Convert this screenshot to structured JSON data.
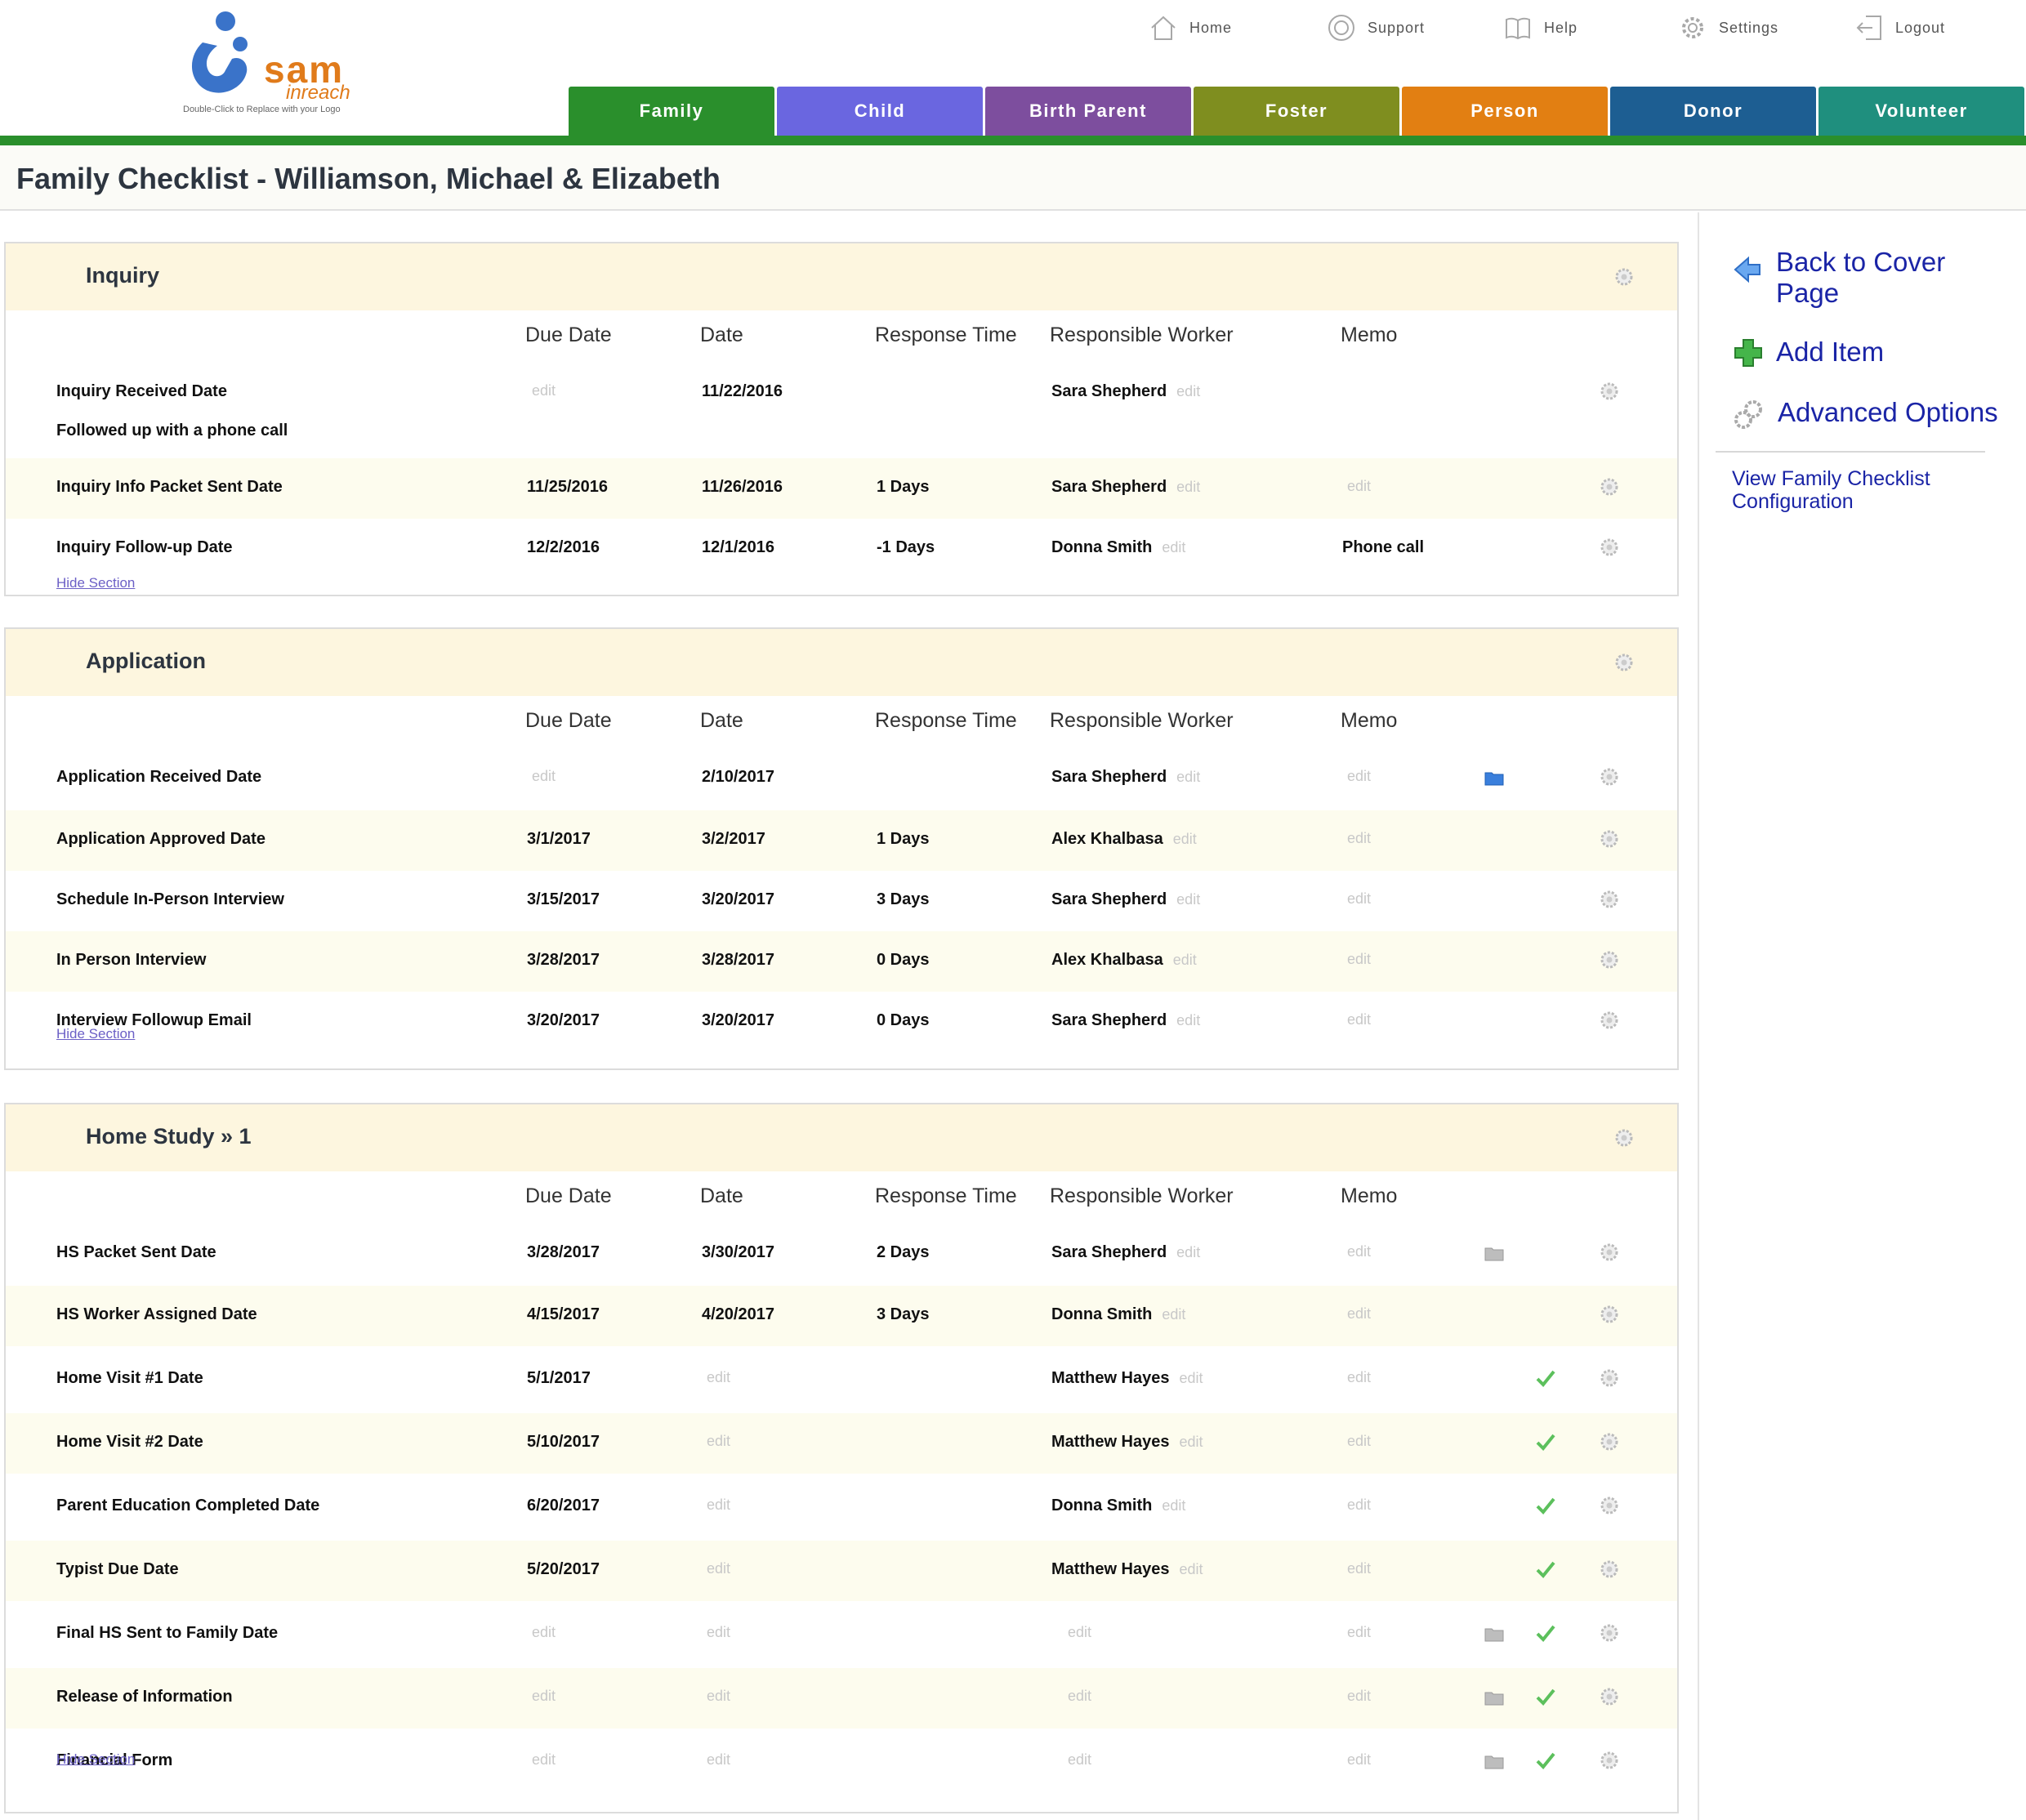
{
  "logo": {
    "brand": "sam",
    "sub": "inreach",
    "caption": "Double-Click to Replace with your Logo"
  },
  "topnav": [
    {
      "label": "Home",
      "icon": "home-icon"
    },
    {
      "label": "Support",
      "icon": "lifebuoy-icon"
    },
    {
      "label": "Help",
      "icon": "book-icon"
    },
    {
      "label": "Settings",
      "icon": "gear-icon"
    },
    {
      "label": "Logout",
      "icon": "logout-icon"
    }
  ],
  "tabs": [
    {
      "label": "Family",
      "color": "#2a8f2c"
    },
    {
      "label": "Child",
      "color": "#6a66e0"
    },
    {
      "label": "Birth Parent",
      "color": "#7d4e9e"
    },
    {
      "label": "Foster",
      "color": "#7f8e1f"
    },
    {
      "label": "Person",
      "color": "#e27f12"
    },
    {
      "label": "Donor",
      "color": "#1d5e92"
    },
    {
      "label": "Volunteer",
      "color": "#1f8f7e"
    }
  ],
  "page_title": "Family Checklist - Williamson, Michael & Elizabeth",
  "columns": {
    "due_date": "Due Date",
    "date": "Date",
    "response_time": "Response Time",
    "worker": "Responsible Worker",
    "memo": "Memo"
  },
  "edit_label": "edit",
  "hide_section_label": "Hide Section",
  "sections": [
    {
      "title": "Inquiry",
      "rows": [
        {
          "label": "Inquiry Received Date",
          "due": "",
          "date": "11/22/2016",
          "response": "",
          "worker": "Sara Shepherd",
          "memo": ""
        },
        {
          "label": "Inquiry Info Packet Sent Date",
          "due": "11/25/2016",
          "date": "11/26/2016",
          "response": "1 Days",
          "worker": "Sara Shepherd",
          "memo": ""
        },
        {
          "label": "Inquiry Follow-up Date",
          "due": "12/2/2016",
          "date": "12/1/2016",
          "response": "-1 Days",
          "worker": "Donna Smith",
          "memo": "Phone call"
        }
      ],
      "note": "Followed up with a phone call"
    },
    {
      "title": "Application",
      "rows": [
        {
          "label": "Application Received Date",
          "due": "",
          "date": "2/10/2017",
          "response": "",
          "worker": "Sara Shepherd",
          "memo": ""
        },
        {
          "label": "Application Approved Date",
          "due": "3/1/2017",
          "date": "3/2/2017",
          "response": "1 Days",
          "worker": "Alex Khalbasa",
          "memo": ""
        },
        {
          "label": "Schedule In-Person Interview",
          "due": "3/15/2017",
          "date": "3/20/2017",
          "response": "3 Days",
          "worker": "Sara Shepherd",
          "memo": ""
        },
        {
          "label": "In Person Interview",
          "due": "3/28/2017",
          "date": "3/28/2017",
          "response": "0 Days",
          "worker": "Alex Khalbasa",
          "memo": ""
        },
        {
          "label": "Interview Followup Email",
          "due": "3/20/2017",
          "date": "3/20/2017",
          "response": "0 Days",
          "worker": "Sara Shepherd",
          "memo": ""
        }
      ]
    },
    {
      "title": "Home Study » 1",
      "rows": [
        {
          "label": "HS Packet Sent Date",
          "due": "3/28/2017",
          "date": "3/30/2017",
          "response": "2 Days",
          "worker": "Sara Shepherd",
          "memo": ""
        },
        {
          "label": "HS Worker Assigned Date",
          "due": "4/15/2017",
          "date": "4/20/2017",
          "response": "3 Days",
          "worker": "Donna Smith",
          "memo": ""
        },
        {
          "label": "Home Visit #1 Date",
          "due": "5/1/2017",
          "date": "",
          "response": "",
          "worker": "Matthew Hayes",
          "memo": ""
        },
        {
          "label": "Home Visit #2 Date",
          "due": "5/10/2017",
          "date": "",
          "response": "",
          "worker": "Matthew Hayes",
          "memo": ""
        },
        {
          "label": "Parent Education Completed Date",
          "due": "6/20/2017",
          "date": "",
          "response": "",
          "worker": "Donna Smith",
          "memo": ""
        },
        {
          "label": "Typist Due Date",
          "due": "5/20/2017",
          "date": "",
          "response": "",
          "worker": "Matthew Hayes",
          "memo": ""
        },
        {
          "label": "Final HS Sent to Family Date",
          "due": "",
          "date": "",
          "response": "",
          "worker": "",
          "memo": ""
        },
        {
          "label": "Release of Information",
          "due": "",
          "date": "",
          "response": "",
          "worker": "",
          "memo": ""
        },
        {
          "label": "Financial Form",
          "due": "",
          "date": "",
          "response": "",
          "worker": "",
          "memo": ""
        }
      ]
    }
  ],
  "sidebar": {
    "back_label": "Back to Cover Page",
    "add_label": "Add Item",
    "advanced_label": "Advanced Options",
    "config_label": "View Family Checklist Configuration"
  },
  "colors": {
    "link": "#1a24a6",
    "section_header": "#fdf6df",
    "row_alt": "#fdfcee",
    "check": "#5cc05c"
  }
}
